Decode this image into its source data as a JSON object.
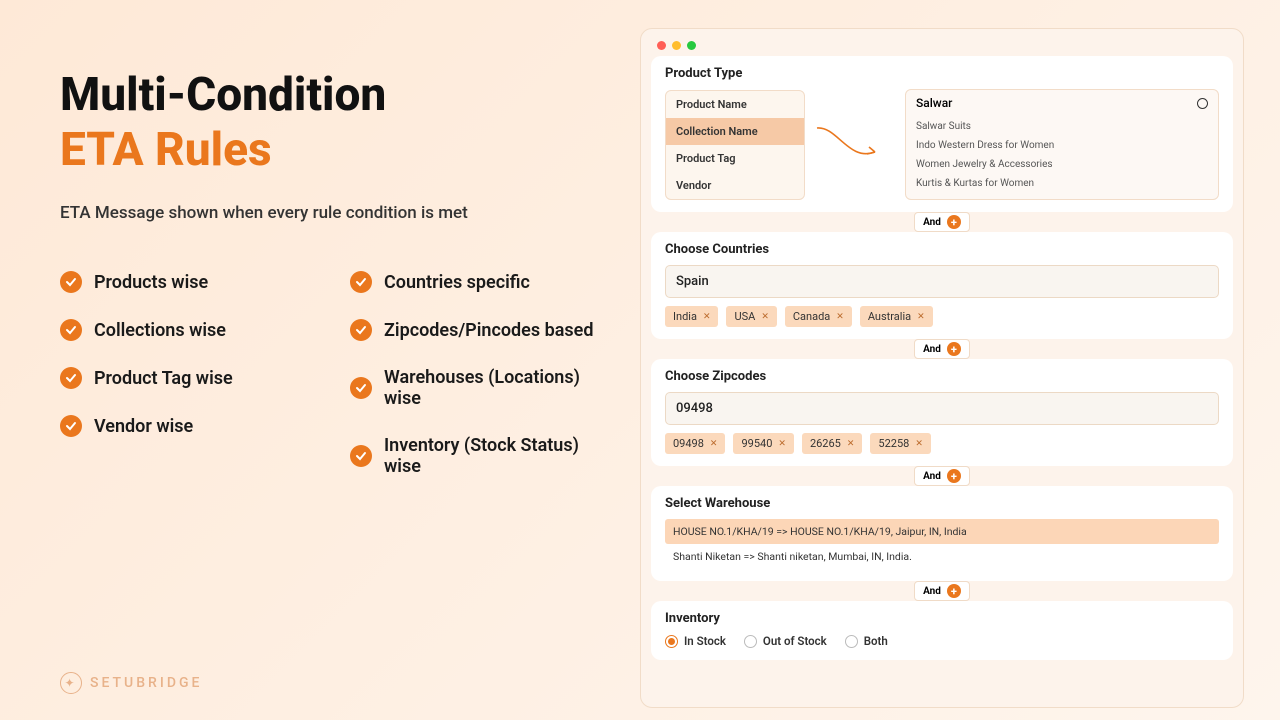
{
  "left": {
    "title1": "Multi-Condition",
    "title2": "ETA Rules",
    "subtitle": "ETA Message shown when every rule condition is met",
    "featuresCol1": [
      "Products wise",
      "Collections wise",
      "Product Tag wise",
      "Vendor wise"
    ],
    "featuresCol2": [
      "Countries specific",
      "Zipcodes/Pincodes based",
      "Warehouses (Locations) wise",
      "Inventory (Stock Status) wise"
    ],
    "brand": "SETUBRIDGE"
  },
  "and_label": "And",
  "product_type": {
    "title": "Product Type",
    "options": [
      "Product Name",
      "Collection Name",
      "Product Tag",
      "Vendor"
    ],
    "selected": "Collection Name",
    "search": "Salwar",
    "suggestions": [
      "Salwar Suits",
      "Indo Western Dress for Women",
      "Women Jewelry & Accessories",
      "Kurtis & Kurtas for Women"
    ]
  },
  "countries": {
    "title": "Choose Countries",
    "input": "Spain",
    "chips": [
      "India",
      "USA",
      "Canada",
      "Australia"
    ]
  },
  "zipcodes": {
    "title": "Choose Zipcodes",
    "input": "09498",
    "chips": [
      "09498",
      "99540",
      "26265",
      "52258"
    ]
  },
  "warehouse": {
    "title": "Select Warehouse",
    "rows": [
      "HOUSE NO.1/KHA/19 => HOUSE NO.1/KHA/19, Jaipur, IN, India",
      "Shanti Niketan => Shanti niketan, Mumbai, IN, India."
    ],
    "selected": 0
  },
  "inventory": {
    "title": "Inventory",
    "options": [
      "In Stock",
      "Out of Stock",
      "Both"
    ],
    "selected": "In Stock"
  }
}
